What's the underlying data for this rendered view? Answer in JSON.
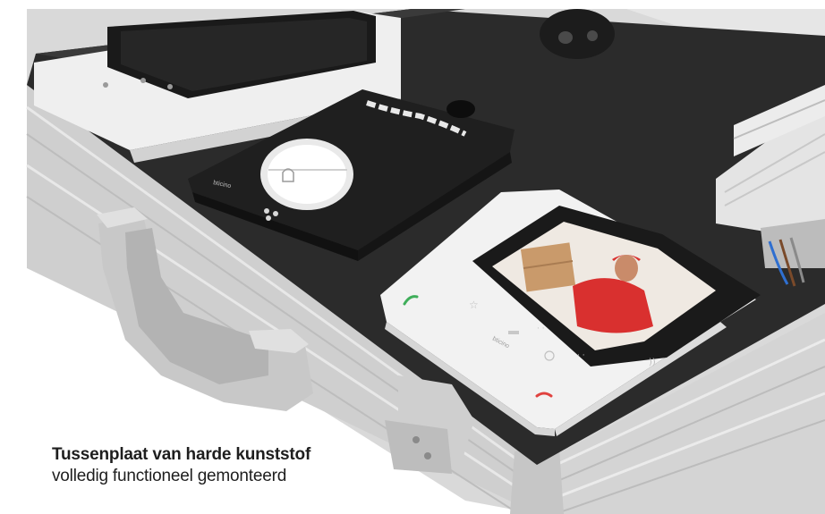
{
  "caption": {
    "title": "Tussenplaat van harde kunststof",
    "subtitle": "volledig functioneel gemonteerd"
  },
  "device_text": {
    "entrance_panel_brand": "bticino",
    "monitor_brand": "bticino"
  },
  "colors": {
    "background": "#ffffff",
    "case_aluminium": "#dcdcdc",
    "interior_board": "#2b2b2b",
    "monitor_body": "#f2f2f2",
    "screen_frame": "#1a1a1a",
    "answer_green": "#3fae5a",
    "hangup_red": "#e0423f"
  },
  "icons": [
    "phone-answer-icon",
    "phone-hangup-icon",
    "bell-icon",
    "key-icon",
    "star-icon",
    "wifi-icon"
  ]
}
